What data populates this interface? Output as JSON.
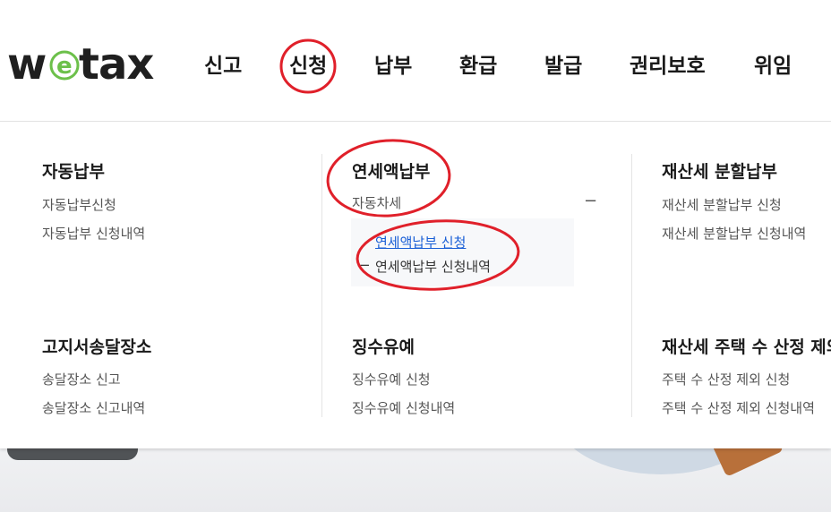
{
  "header": {
    "logo_text": "wetax",
    "nav": [
      "신고",
      "신청",
      "납부",
      "환급",
      "발급",
      "권리보호",
      "위임"
    ]
  },
  "menu": {
    "col1": {
      "sec1": {
        "title": "자동납부",
        "links": [
          "자동납부신청",
          "자동납부 신청내역"
        ]
      },
      "sec2": {
        "title": "고지서송달장소",
        "links": [
          "송달장소 신고",
          "송달장소 신고내역"
        ]
      }
    },
    "col2": {
      "sec1": {
        "title": "연세액납부",
        "links": [
          "자동차세"
        ],
        "toggle": "−",
        "sublinks": [
          "연세액납부 신청",
          "연세액납부 신청내역"
        ],
        "sub_dash": "−"
      },
      "sec2": {
        "title": "징수유예",
        "links": [
          "징수유예 신청",
          "징수유예 신청내역"
        ]
      }
    },
    "col3": {
      "sec1": {
        "title": "재산세 분할납부",
        "links": [
          "재산세 분할납부 신청",
          "재산세 분할납부 신청내역"
        ]
      },
      "sec2": {
        "title": "재산세 주택 수 산정 제외",
        "links": [
          "주택 수 산정 제외 신청",
          "주택 수 산정 제외 신청내역"
        ]
      }
    }
  },
  "colors": {
    "accent_link": "#1a5fd6",
    "annotation": "#e0202a",
    "logo_green": "#6cc04a"
  }
}
